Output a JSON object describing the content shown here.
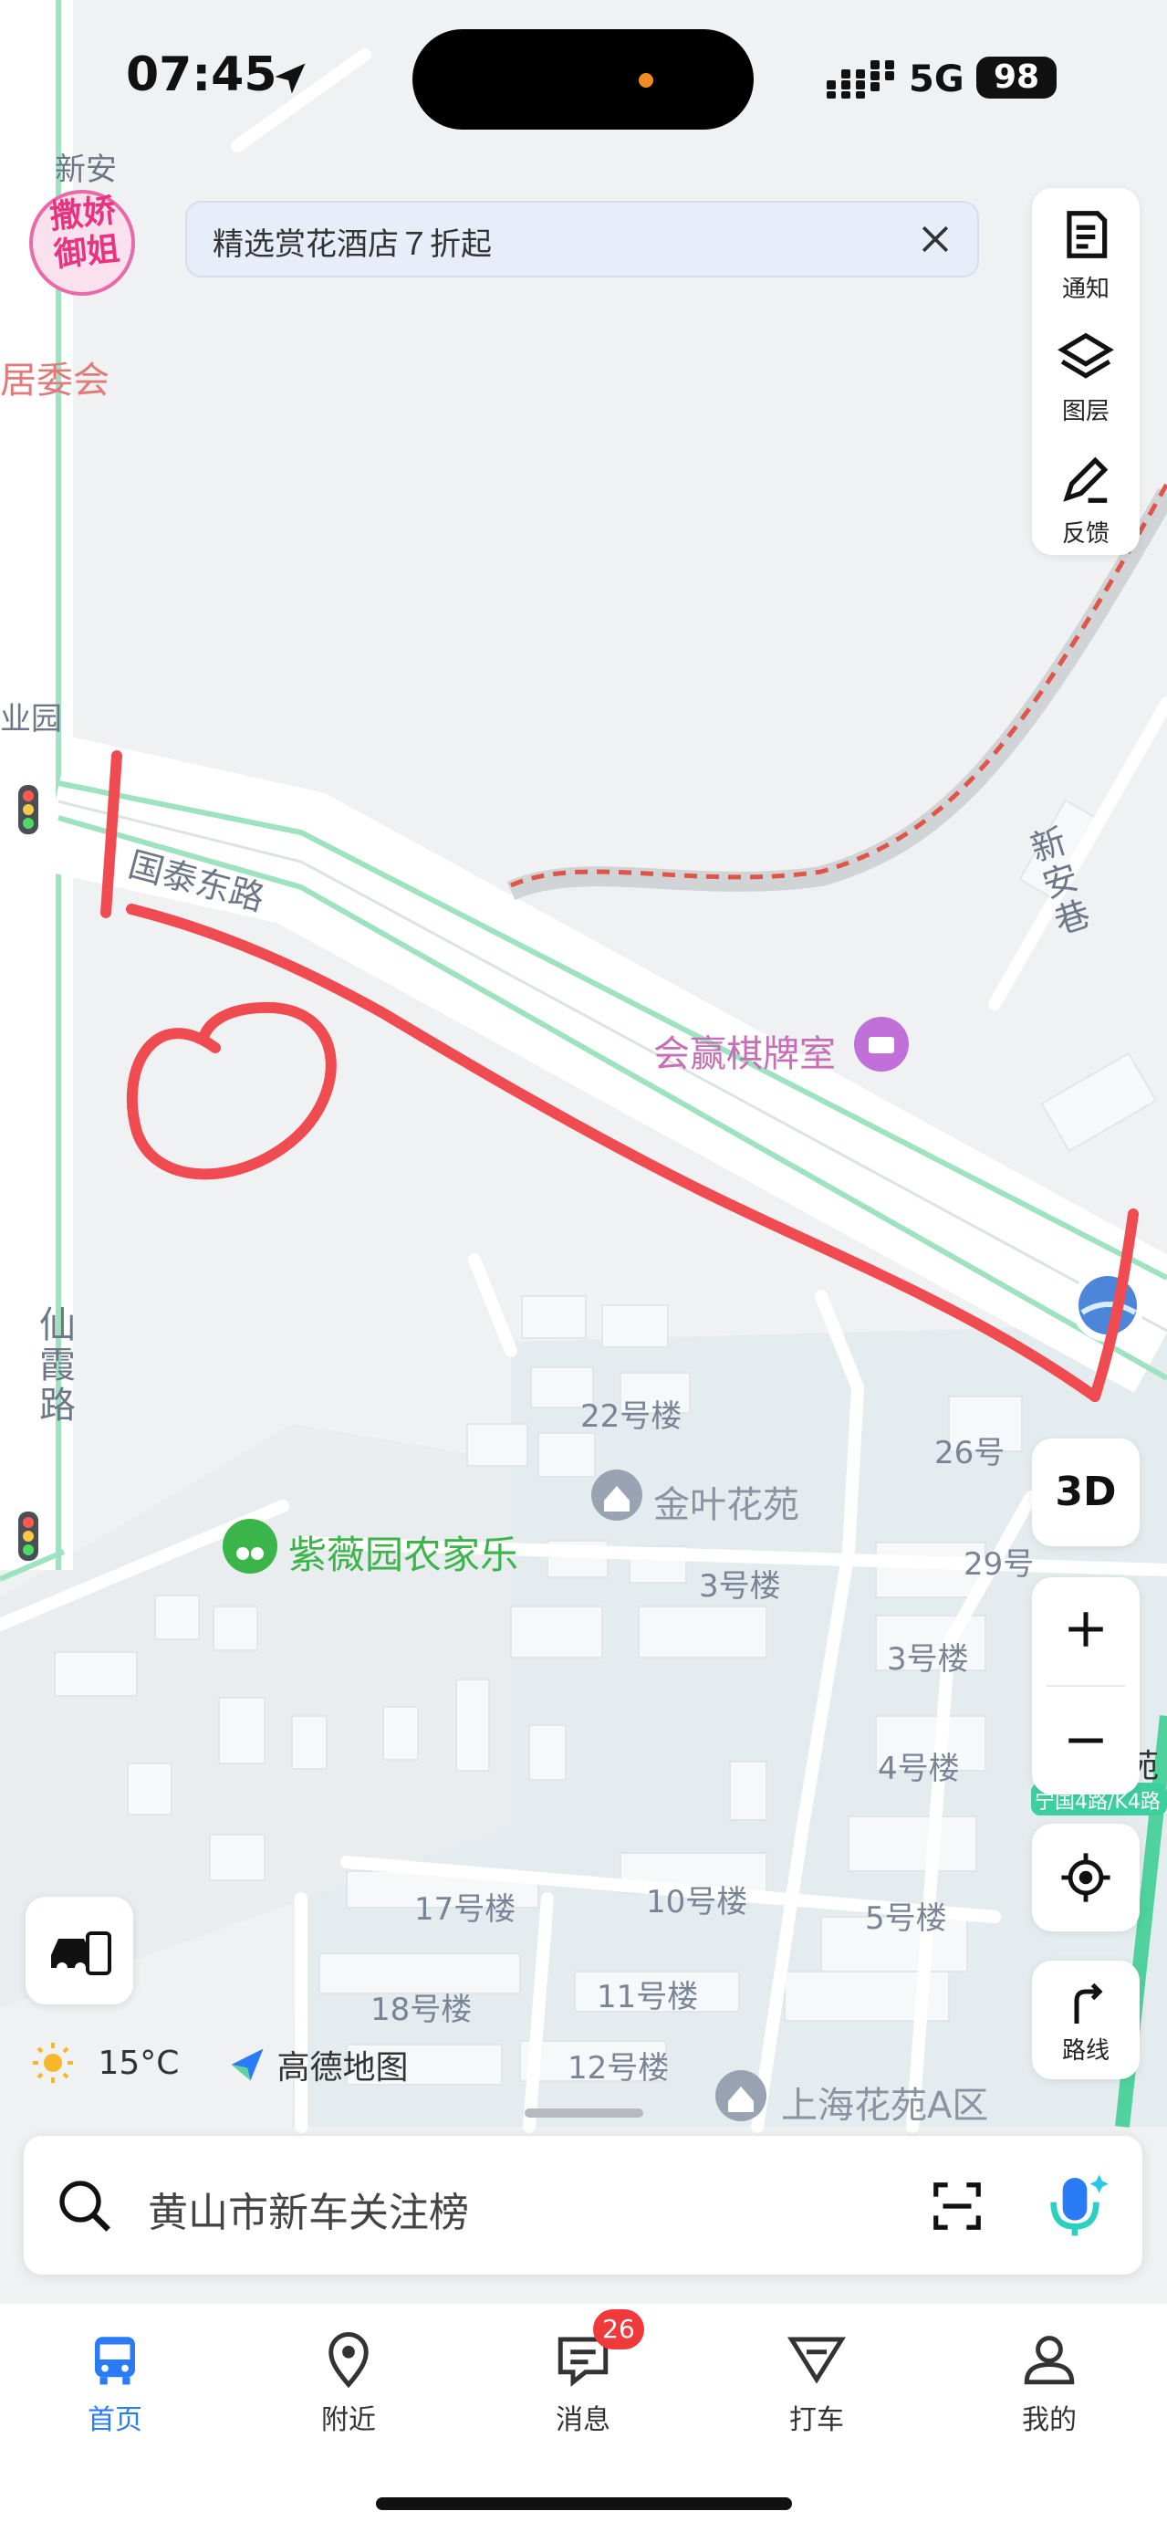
{
  "status_bar": {
    "time": "07:45",
    "network": "5G",
    "battery": "98"
  },
  "banner": {
    "text": "精选赏花酒店７折起"
  },
  "map_labels": {
    "xinan": "新安",
    "juweihui": "居委会",
    "yeyuan": "业园",
    "guotai_road": "国泰东路",
    "xinan_lane": "新安巷",
    "chess_room": "会赢棋牌室",
    "xianxia_road": "仙霞路",
    "b22": "22号楼",
    "jinye": "金叶花苑",
    "b26": "26号",
    "ziwei": "紫薇园农家乐",
    "b3a": "3号楼",
    "b29": "29号",
    "b3b": "3号楼",
    "b4": "4号楼",
    "bus_route": "宁国4路/K4路",
    "yuan_partial": "苑",
    "b17": "17号楼",
    "b10": "10号楼",
    "b5": "5号楼",
    "b18": "18号楼",
    "b11": "11号楼",
    "b12": "12号楼",
    "shanghai": "上海花苑A区",
    "sticker_top": "撒娇",
    "sticker_bottom": "御姐"
  },
  "tools": {
    "notify": "通知",
    "layers": "图层",
    "feedback": "反馈",
    "three_d": "3D",
    "route": "路线"
  },
  "weather": {
    "temp": "15°C"
  },
  "brand": {
    "name": "高德地图"
  },
  "search": {
    "placeholder": "黄山市新车关注榜"
  },
  "tabs": [
    {
      "label": "首页",
      "icon": "bus-icon"
    },
    {
      "label": "附近",
      "icon": "location-pin-icon"
    },
    {
      "label": "消息",
      "icon": "message-icon",
      "badge": "26"
    },
    {
      "label": "打车",
      "icon": "taxi-icon"
    },
    {
      "label": "我的",
      "icon": "user-icon"
    }
  ],
  "colors": {
    "accent": "#2a7cf6",
    "annotation": "#ef4b51",
    "road_green": "#9ee3c0",
    "badge": "#f0393a"
  }
}
